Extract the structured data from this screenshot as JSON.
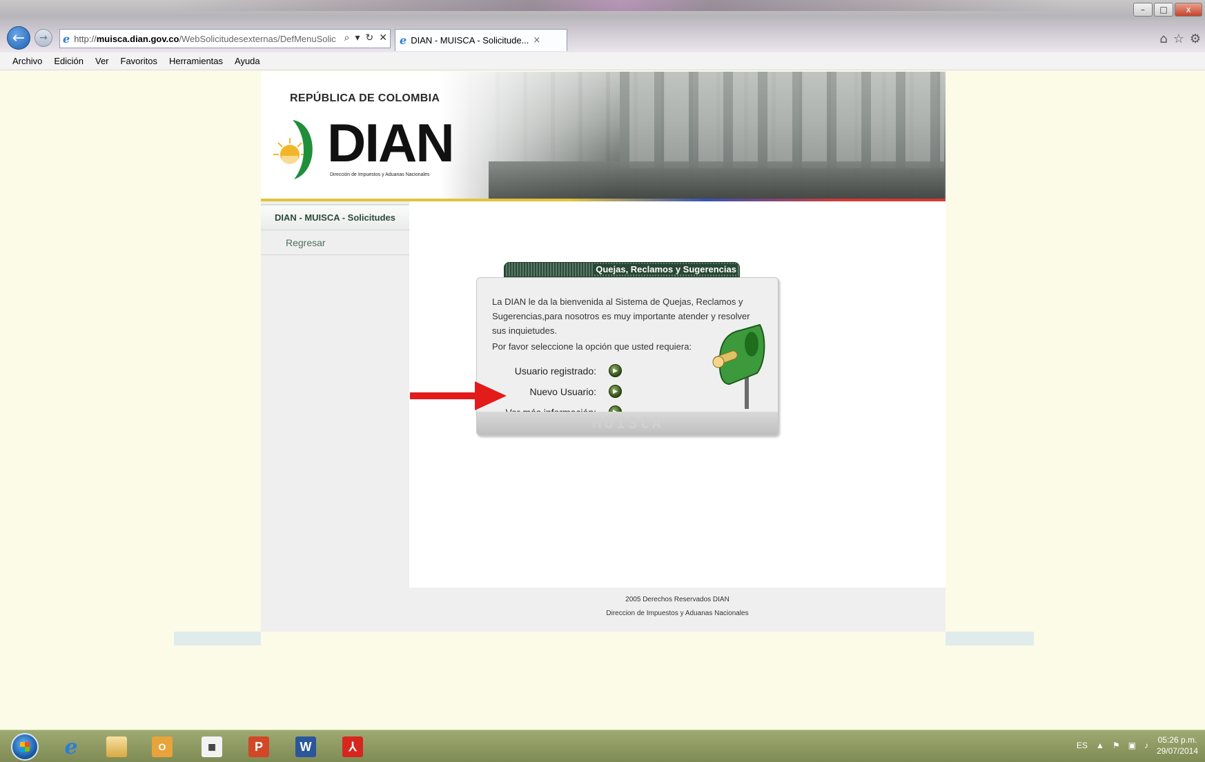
{
  "browser": {
    "url_proto": "http://",
    "url_host": "muisca.dian.gov.co",
    "url_path": "/WebSolicitudesexternas/DefMenuSolic",
    "address_icons": [
      "search-icon",
      "dropdown-icon",
      "refresh-icon",
      "stop-icon"
    ],
    "tab_title": "DIAN - MUISCA - Solicitude...",
    "tab_close": "×",
    "window_controls": [
      "–",
      "□",
      "x"
    ],
    "toolbar_icons": [
      "home-icon",
      "favorites-icon",
      "settings-icon"
    ]
  },
  "menu": [
    "Archivo",
    "Edición",
    "Ver",
    "Favoritos",
    "Herramientas",
    "Ayuda"
  ],
  "header": {
    "republic": "REPÚBLICA DE COLOMBIA",
    "logo_text": "DIAN",
    "logo_subtitle": "Dirección de Impuestos y Aduanas Nacionales"
  },
  "sidebar": {
    "title": "DIAN - MUISCA - Solicitudes",
    "back_link": "Regresar"
  },
  "panel": {
    "title": "Quejas, Reclamos y Sugerencias",
    "welcome": "La DIAN le da la bienvenida al Sistema de Quejas, Reclamos y Sugerencias,para nosotros es muy importante atender y resolver sus inquietudes.",
    "prompt": "Por favor seleccione la opción que usted requiera:",
    "options": [
      {
        "label": "Usuario registrado:"
      },
      {
        "label": "Nuevo Usuario:"
      },
      {
        "label": "Ver más información:"
      }
    ],
    "brand": "MUISCA"
  },
  "footer": {
    "rights": "2005 Derechos Reservados DIAN",
    "entity": "Direccion de Impuestos y Aduanas Nacionales"
  },
  "taskbar": {
    "apps": [
      "internet-explorer",
      "file-explorer",
      "outlook",
      "calendar",
      "powerpoint",
      "word",
      "acrobat"
    ],
    "language": "ES",
    "time": "05:26 p.m.",
    "date": "29/07/2014"
  },
  "colors": {
    "annotation_arrow": "#e31b1b",
    "panel_header": "#294736",
    "sidebar_link": "#4f6f5d"
  }
}
